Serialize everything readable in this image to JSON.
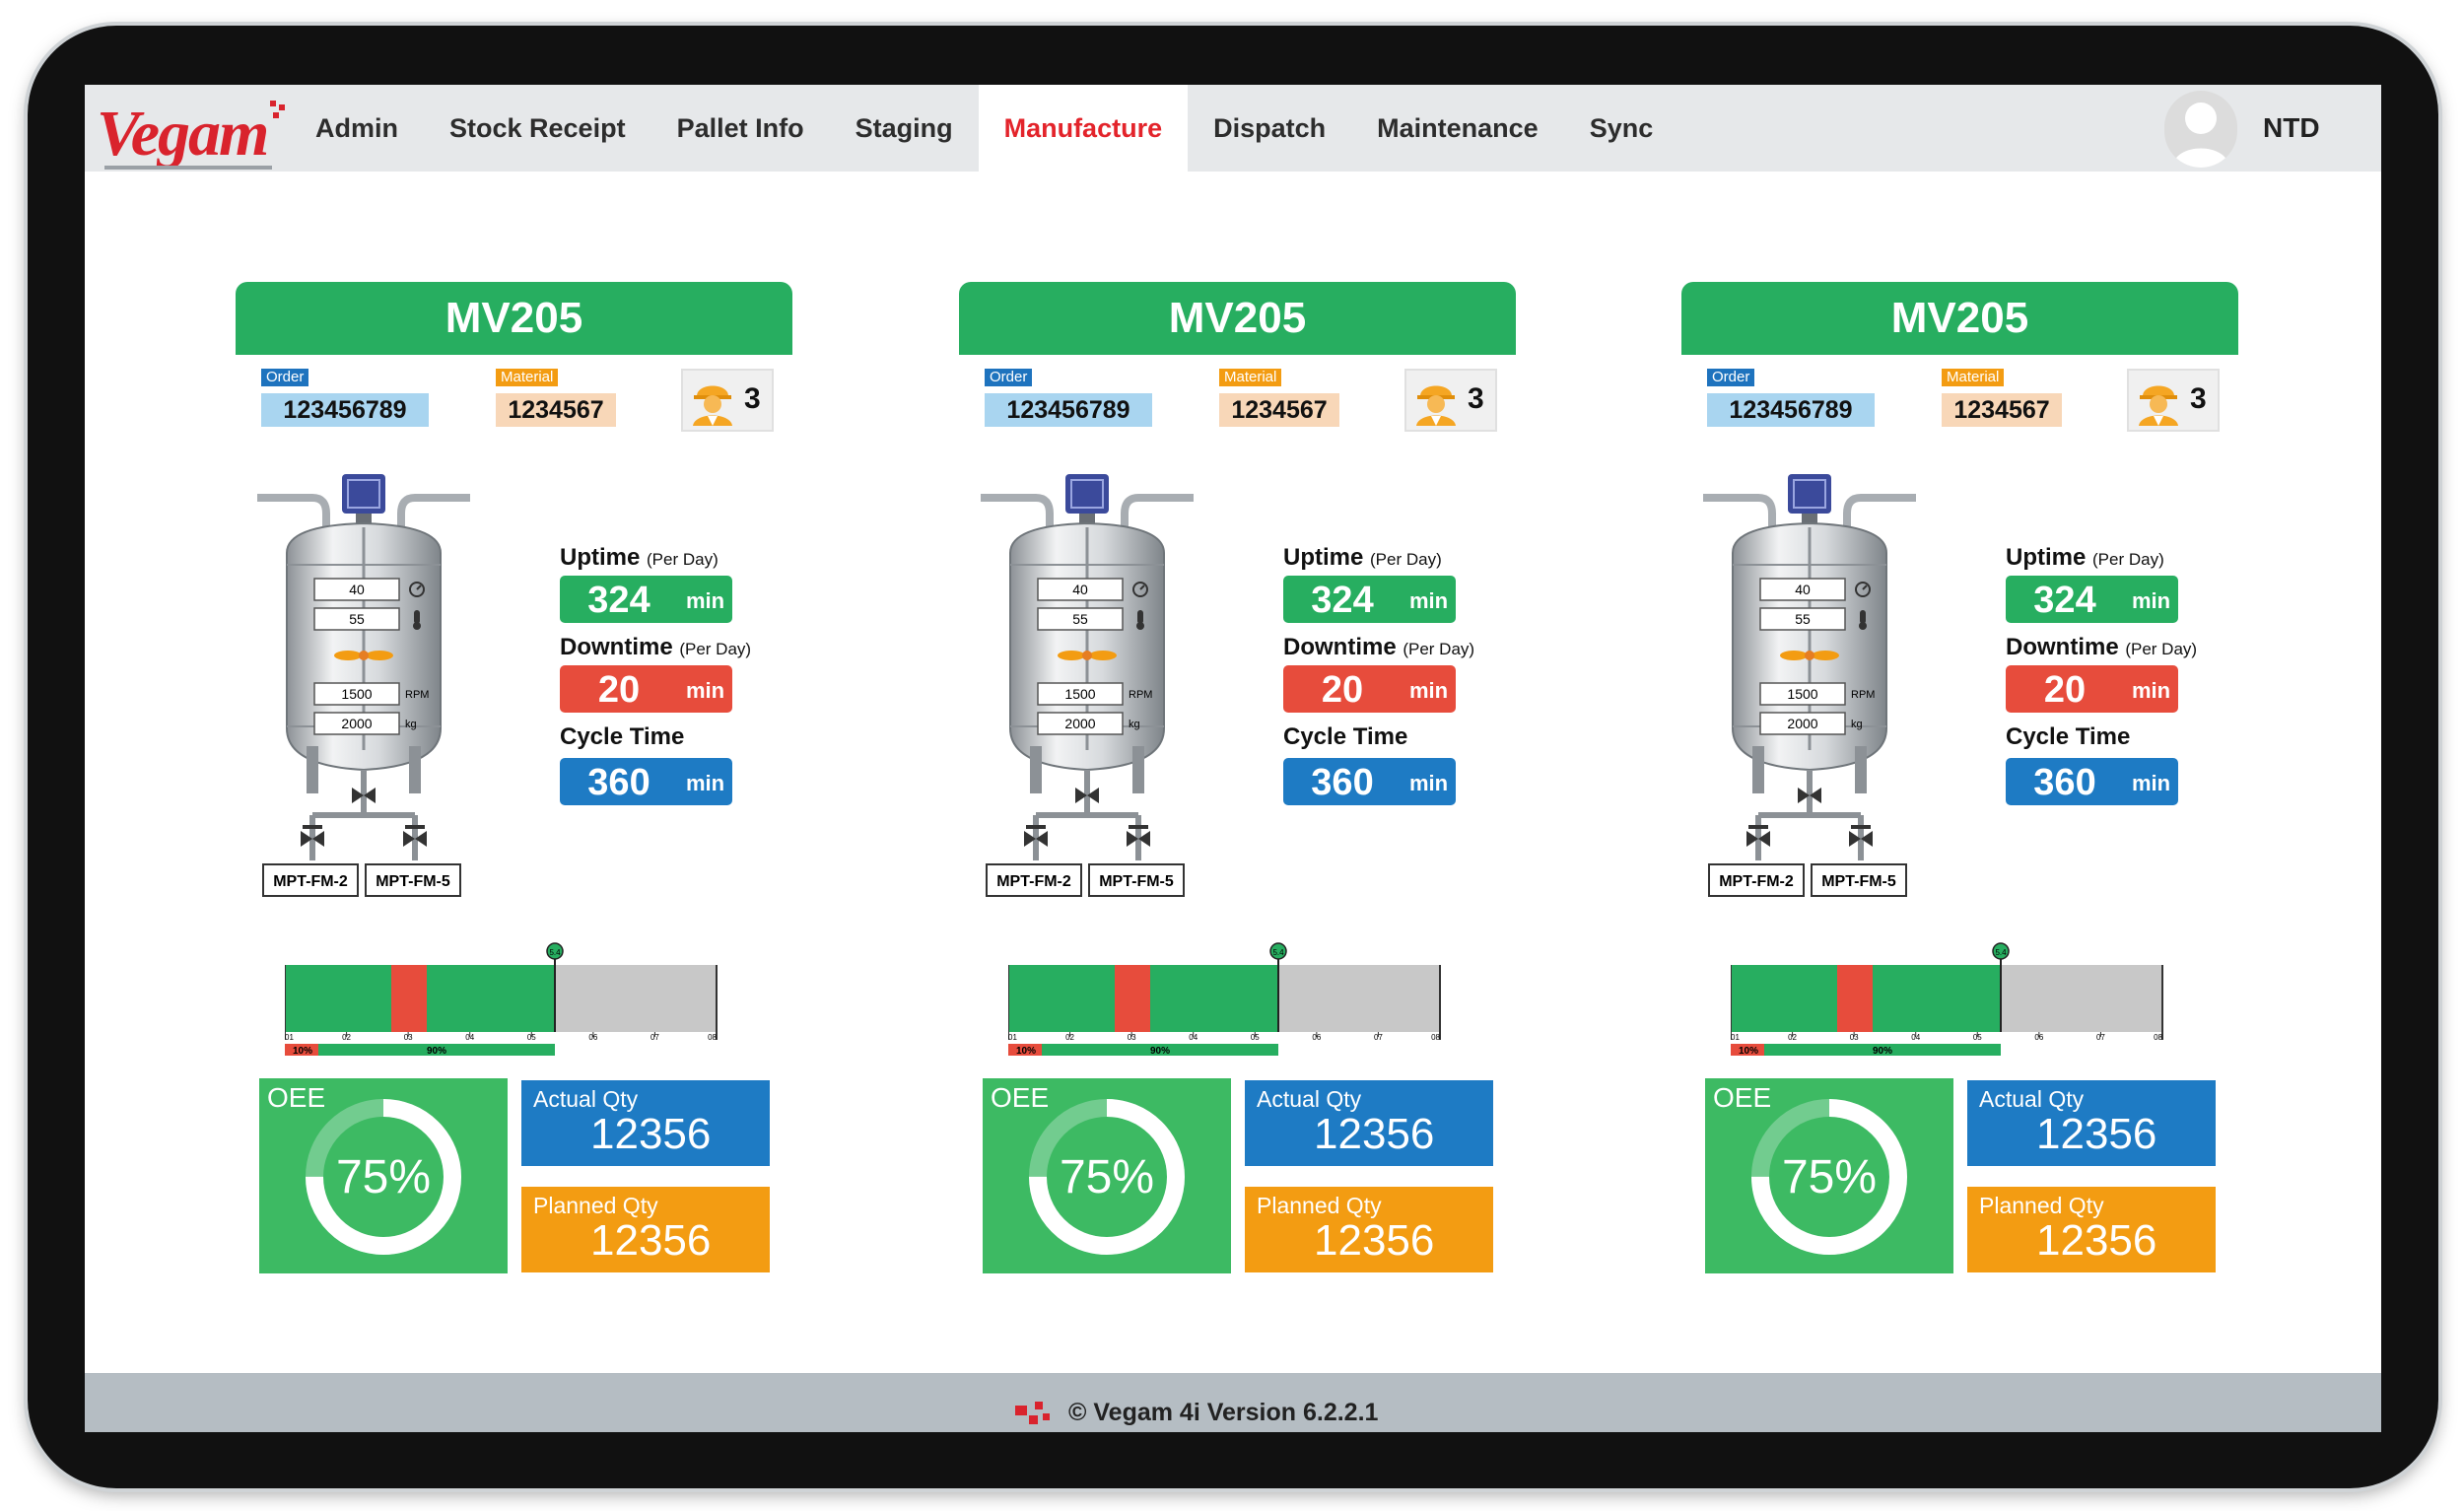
{
  "app": {
    "logo_text": "Vegam",
    "user_name": "NTD",
    "footer_text": "© Vegam 4i Version 6.2.2.1"
  },
  "nav": {
    "items": [
      "Admin",
      "Stock Receipt",
      "Pallet Info",
      "Staging",
      "Manufacture",
      "Dispatch",
      "Maintenance",
      "Sync"
    ],
    "active": "Manufacture"
  },
  "labels": {
    "order": "Order",
    "material": "Material",
    "uptime": "Uptime",
    "downtime": "Downtime",
    "per_day": "(Per Day)",
    "cycle_time": "Cycle Time",
    "unit_min": "min",
    "oee": "OEE",
    "actual_qty": "Actual Qty",
    "planned_qty": "Planned Qty"
  },
  "machines": [
    {
      "name": "MV205",
      "order": "123456789",
      "material": "1234567",
      "operators": "3",
      "uptime": "324",
      "downtime": "20",
      "cycle_time": "360",
      "oee": "75%",
      "oee_fraction": 0.75,
      "actual_qty": "12356",
      "planned_qty": "12356",
      "tank": {
        "reading_1": "40",
        "reading_2": "55",
        "speed": "1500",
        "speed_unit": "RPM",
        "weight": "2000",
        "weight_unit": "kg"
      },
      "outlets": [
        "MPT-FM-2",
        "MPT-FM-5"
      ],
      "timeline": {
        "ticks": [
          "01",
          "02",
          "03",
          "04",
          "05",
          "06",
          "07",
          "08"
        ],
        "marker": "5.4",
        "downtime_pct": "10%",
        "uptime_pct": "90%"
      }
    },
    {
      "name": "MV205",
      "order": "123456789",
      "material": "1234567",
      "operators": "3",
      "uptime": "324",
      "downtime": "20",
      "cycle_time": "360",
      "oee": "75%",
      "oee_fraction": 0.75,
      "actual_qty": "12356",
      "planned_qty": "12356",
      "tank": {
        "reading_1": "40",
        "reading_2": "55",
        "speed": "1500",
        "speed_unit": "RPM",
        "weight": "2000",
        "weight_unit": "kg"
      },
      "outlets": [
        "MPT-FM-2",
        "MPT-FM-5"
      ],
      "timeline": {
        "ticks": [
          "01",
          "02",
          "03",
          "04",
          "05",
          "06",
          "07",
          "08"
        ],
        "marker": "5.4",
        "downtime_pct": "10%",
        "uptime_pct": "90%"
      }
    },
    {
      "name": "MV205",
      "order": "123456789",
      "material": "1234567",
      "operators": "3",
      "uptime": "324",
      "downtime": "20",
      "cycle_time": "360",
      "oee": "75%",
      "oee_fraction": 0.75,
      "actual_qty": "12356",
      "planned_qty": "12356",
      "tank": {
        "reading_1": "40",
        "reading_2": "55",
        "speed": "1500",
        "speed_unit": "RPM",
        "weight": "2000",
        "weight_unit": "kg"
      },
      "outlets": [
        "MPT-FM-2",
        "MPT-FM-5"
      ],
      "timeline": {
        "ticks": [
          "01",
          "02",
          "03",
          "04",
          "05",
          "06",
          "07",
          "08"
        ],
        "marker": "5.4",
        "downtime_pct": "10%",
        "uptime_pct": "90%"
      }
    }
  ],
  "colors": {
    "brand_red": "#d9232d",
    "header_green": "#27ae60",
    "downtime_red": "#e74c3c",
    "cycle_blue": "#1e7bc4",
    "planned_orange": "#f39c12"
  }
}
